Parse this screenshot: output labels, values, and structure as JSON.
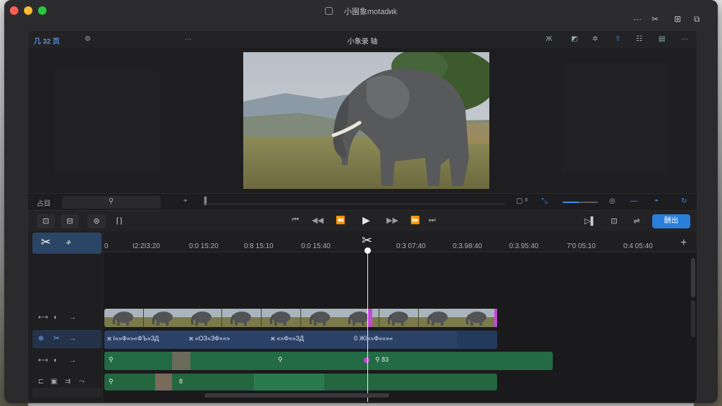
{
  "window": {
    "title": "小園象motadиk",
    "right_controls": [
      "···",
      "✂",
      "⊞",
      "⧉"
    ]
  },
  "top_toolbar": {
    "library_label": "几 32 页",
    "gear_icon": "gear-icon",
    "more_left": "···",
    "viewer_title": "小象录 轴",
    "right_tools": [
      "Ж",
      "◩",
      "✲",
      "⇧",
      "☷",
      "▤",
      "···"
    ]
  },
  "scrub_row": {
    "left_label": "占目",
    "pin_icon": "pin-icon",
    "add_label": "+",
    "clip_start_icon": "▐",
    "right_label": "▢ ⁸",
    "zoom_level": 0.45
  },
  "controls": {
    "left_tools": [
      "⊡",
      "⊟",
      "⊜",
      "⌈⌉"
    ],
    "transport": [
      "⏮",
      "◀◀",
      "⏪",
      "▶",
      "▶▶",
      "⏩",
      "⏭"
    ],
    "right_tools": [
      "▷▌",
      "⊡",
      "⇌"
    ],
    "export_label": "酬出"
  },
  "timeline": {
    "selected_tool_label": "ቶ",
    "ruler_ticks": [
      "0",
      "I2:2I3:20",
      "0:0 15:20",
      "0:8 15:10",
      "0:0 15:40",
      "0:3 07:40",
      "0:3.98:40",
      "0:3.95:40",
      "7'0 05:10",
      "0:4 05:40"
    ],
    "track_heads": [
      {
        "icons": [
          "⟷",
          "◐",
          "→"
        ],
        "active": false
      },
      {
        "icons": [
          "⊕",
          "✂",
          "→"
        ],
        "active": true
      },
      {
        "icons": [
          "⟷",
          "◐",
          "→"
        ],
        "active": false
      },
      {
        "icons": [
          "⊏",
          "▣",
          "⇉",
          "⤳"
        ],
        "active": false
      }
    ],
    "audio_labels": [
      "ж І«»Ф«»«ФЪ«ЗД",
      "ж «ОЗ«ЗФ««»",
      "ж «»Ф«»ЗД",
      "0 ЖІ«»Ф««»«"
    ],
    "green_labels": [
      "⚲",
      "⚲",
      "⚲ 83"
    ],
    "green2_labels": [
      "⚲",
      "8"
    ]
  },
  "colors": {
    "accent": "#2a7fdb",
    "video_clip": "#3a4a2e",
    "audio_clip": "#2b4266",
    "green_clip": "#226b44",
    "marker": "#c24bd6"
  }
}
